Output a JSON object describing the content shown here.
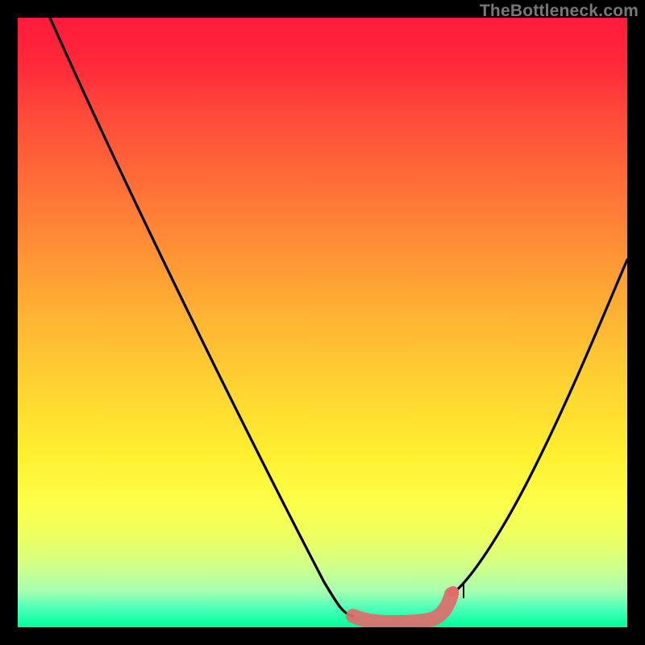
{
  "watermark": "TheBottleneck.com",
  "chart_data": {
    "type": "line",
    "title": "",
    "xlabel": "",
    "ylabel": "",
    "xlim": [
      0,
      100
    ],
    "ylim": [
      0,
      100
    ],
    "grid": false,
    "series": [
      {
        "name": "bottleneck-curve",
        "x": [
          0,
          10,
          20,
          30,
          40,
          48,
          52,
          56,
          60,
          64,
          68,
          72,
          78,
          85,
          92,
          100
        ],
        "values": [
          100,
          84,
          68,
          52,
          36,
          22,
          12,
          5,
          2,
          2,
          4,
          10,
          22,
          38,
          54,
          72
        ]
      },
      {
        "name": "highlight-band",
        "x": [
          52,
          55,
          58,
          61,
          64,
          67,
          70
        ],
        "values": [
          6,
          3,
          2,
          2,
          3,
          5,
          8
        ]
      }
    ],
    "colors": {
      "curve": "#000000",
      "highlight": "#e06b6b",
      "gradient_top": "#ff1a3c",
      "gradient_mid": "#ffd232",
      "gradient_bottom": "#00ff9a"
    }
  }
}
